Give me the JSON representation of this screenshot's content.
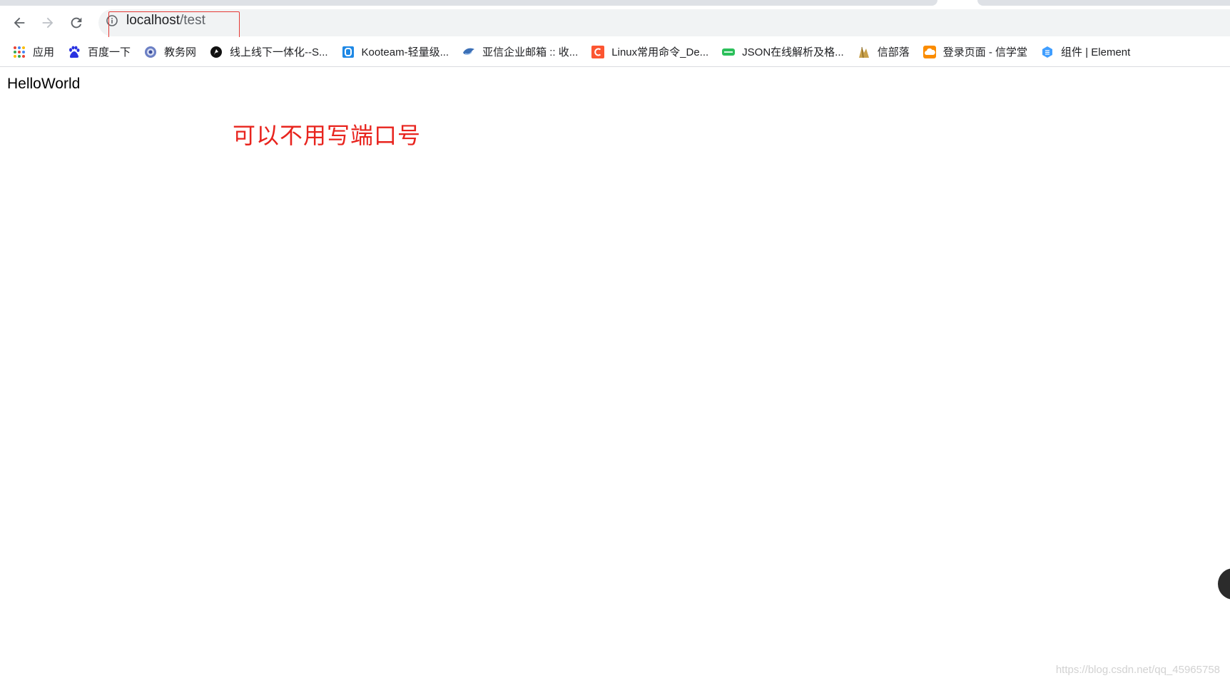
{
  "browser": {
    "url_host": "localhost",
    "url_path": "/test"
  },
  "bookmarks": [
    {
      "label": "应用",
      "icon": "apps-grid-icon"
    },
    {
      "label": "百度一下",
      "icon": "baidu-paw-icon"
    },
    {
      "label": "教务网",
      "icon": "shield-globe-icon"
    },
    {
      "label": "线上线下一体化--S...",
      "icon": "black-circle-icon"
    },
    {
      "label": "Kooteam-轻量级...",
      "icon": "kooteam-icon"
    },
    {
      "label": "亚信企业邮箱 :: 收...",
      "icon": "mail-bird-icon"
    },
    {
      "label": "Linux常用命令_De...",
      "icon": "csdn-c-icon"
    },
    {
      "label": "JSON在线解析及格...",
      "icon": "json-icon"
    },
    {
      "label": "信部落",
      "icon": "tribe-icon"
    },
    {
      "label": "登录页面 - 信学堂",
      "icon": "cloud-orange-icon"
    },
    {
      "label": "组件 | Element",
      "icon": "element-hex-icon"
    }
  ],
  "page": {
    "content_text": "HelloWorld"
  },
  "annotation": {
    "text": "可以不用写端口号",
    "color": "#e8241e"
  },
  "watermark": "https://blog.csdn.net/qq_45965758"
}
